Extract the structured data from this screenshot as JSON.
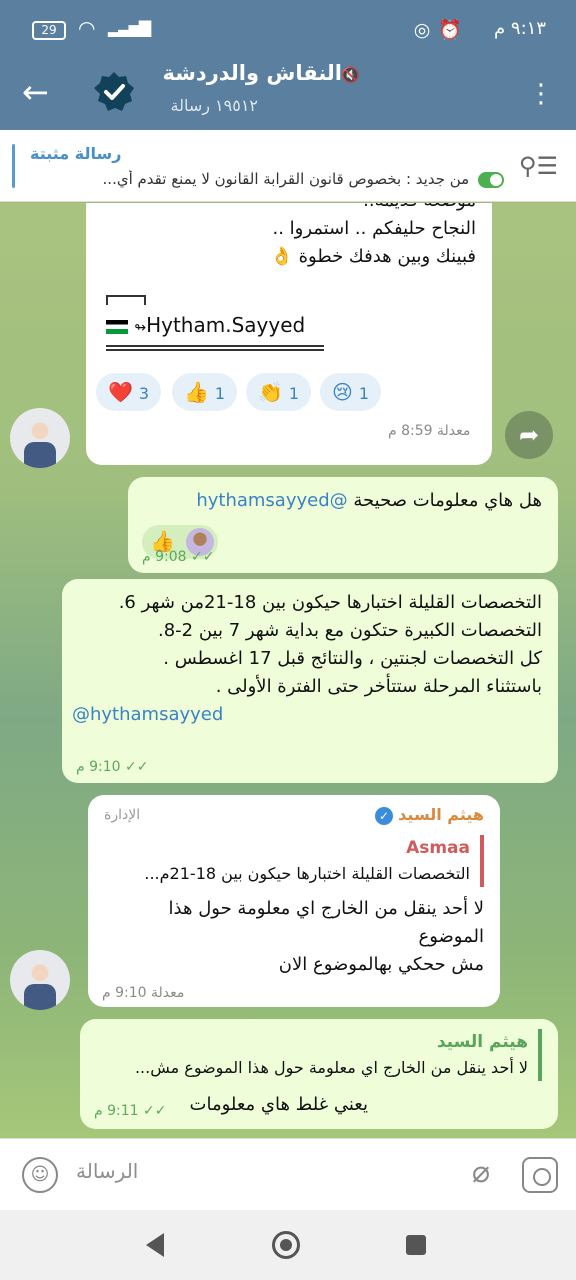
{
  "status_bar": {
    "time": "٩:١٣ م",
    "battery": "29",
    "icons": [
      "whatsapp-icon",
      "alarm-icon",
      "wifi-icon",
      "signal-icon"
    ]
  },
  "header": {
    "title": "النقاش والدردشة",
    "subtitle": "١٩٥١٢ رسالة"
  },
  "pinned": {
    "title": "رسالة مثبتة",
    "text": "من جديد : بخصوص قانون القرابة القانون لا يمنع تقدم أي..."
  },
  "messages": [
    {
      "lines": [
        "موضعة قديمة..",
        "النجاح حليفكم .. استمروا ..",
        "فبينك وبين هدفك خطوة 👌"
      ],
      "signature": "Hytham.Sayyed",
      "reactions": [
        {
          "emoji": "❤️",
          "count": "3"
        },
        {
          "emoji": "👍",
          "count": "1"
        },
        {
          "emoji": "👏",
          "count": "1"
        },
        {
          "emoji": "😢",
          "count": "1"
        }
      ],
      "meta": "معدلة 8:59 م"
    },
    {
      "text": "هل هاي معلومات صحيحة",
      "mention": "@hythamsayyed",
      "reaction_emoji": "👍",
      "meta": "9:08 م"
    },
    {
      "lines": [
        "التخصصات القليلة اختبارها حيكون بين 18-21من شهر 6.",
        "التخصصات الكبيرة حتكون مع بداية شهر 7 بين 2-8.",
        "كل التخصصات لجنتين ، والنتائج قبل 17 اغسطس .",
        "باستثناء المرحلة ستتأخر حتى الفترة الأولى ."
      ],
      "mention": "@hythamsayyed",
      "meta": "9:10 م"
    },
    {
      "sender": "هيثم السيد",
      "role": "الإدارة",
      "reply_name": "Asmaa",
      "reply_text": "التخصصات القليلة اختبارها حيكون بين 18-21م...",
      "lines": [
        "لا أحد ينقل من الخارج اي معلومة حول هذا",
        "الموضوع",
        "مش ححكي بهالموضوع الان"
      ],
      "meta": "معدلة 9:10 م"
    },
    {
      "reply_name": "هيثم السيد",
      "reply_text": "لا أحد ينقل من الخارج اي معلومة حول هذا الموضوع مش...",
      "text": "يعني غلط هاي معلومات",
      "meta": "9:11 م"
    }
  ],
  "composer": {
    "placeholder": "الرسالة"
  },
  "colors": {
    "header": "#5a7f9f",
    "outgoing_bubble": "#effed9",
    "incoming_bubble": "#ffffff",
    "accent": "#3a82c4"
  }
}
